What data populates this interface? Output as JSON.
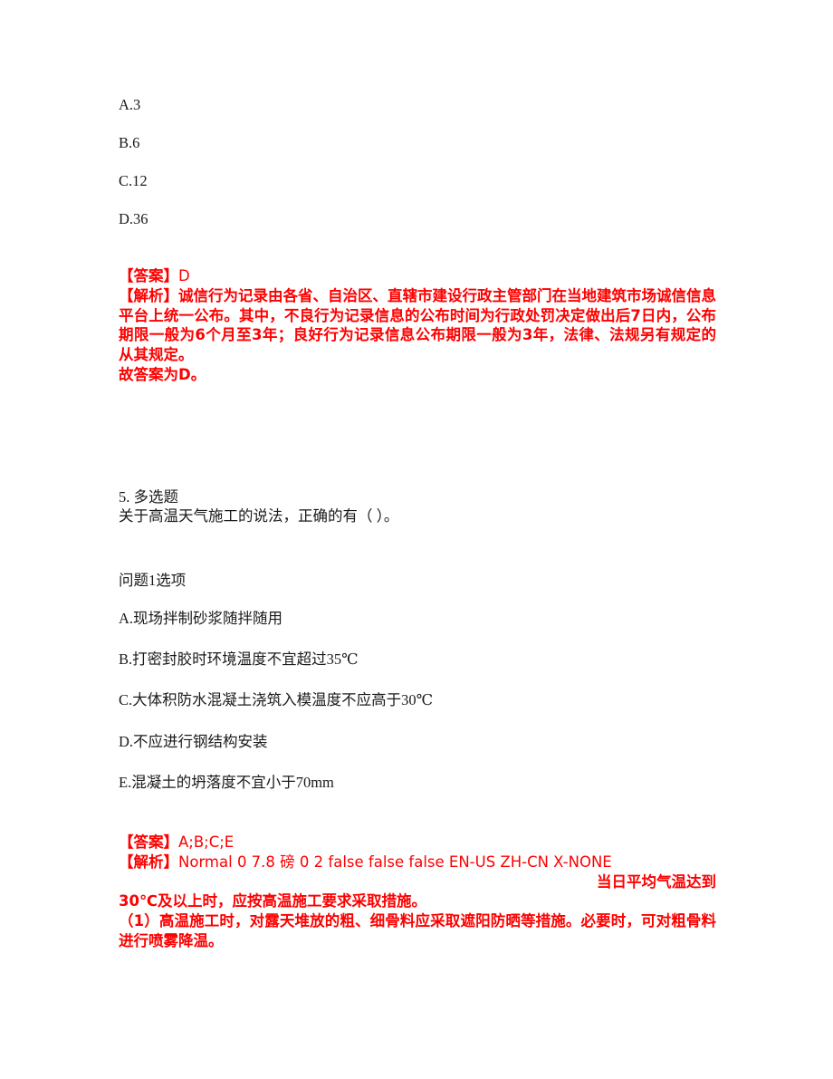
{
  "document": {
    "page_background": "#ffffff",
    "text_color": "#1a1a1a",
    "answer_color": "#fe0000"
  },
  "question_4": {
    "options": [
      "A.3",
      "B.6",
      "C.12",
      "D.36"
    ],
    "answer_label": "【答案】",
    "answer_value": "D",
    "explanation_label": "【解析】",
    "explanation_text": "诚信行为记录由各省、自治区、直辖市建设行政主管部门在当地建筑市场诚信信息平台上统一公布。其中，不良行为记录信息的公布时间为行政处罚决定做出后7日内，公布期限一般为6个月至3年；良好行为记录信息公布期限一般为3年，法律、法规另有规定的从其规定。",
    "conclusion": "故答案为D。"
  },
  "question_5": {
    "number_and_type": "5. 多选题",
    "stem": "关于高温天气施工的说法，正确的有（ ）。",
    "options_heading": "问题1选项",
    "options": [
      "A.现场拌制砂浆随拌随用",
      "B.打密封胶时环境温度不宜超过35℃",
      "C.大体积防水混凝土浇筑入模温度不应高于30℃",
      "D.不应进行钢结构安装",
      "E.混凝土的坍落度不宜小于70mm"
    ],
    "answer_label": "【答案】",
    "answer_value": "A;B;C;E",
    "explanation_label": "【解析】",
    "explanation_artifact": "Normal 0     7.8 磅  0 2   false false false   EN-US ZH-CN X-NONE",
    "explanation_line1_tail": "当日平均气温达到",
    "explanation_line2": "30℃及以上时，应按高温施工要求采取措施。",
    "explanation_item_1": "（1）高温施工时，对露天堆放的粗、细骨料应采取遮阳防晒等措施。必要时，可对粗骨料进行喷雾降温。"
  }
}
